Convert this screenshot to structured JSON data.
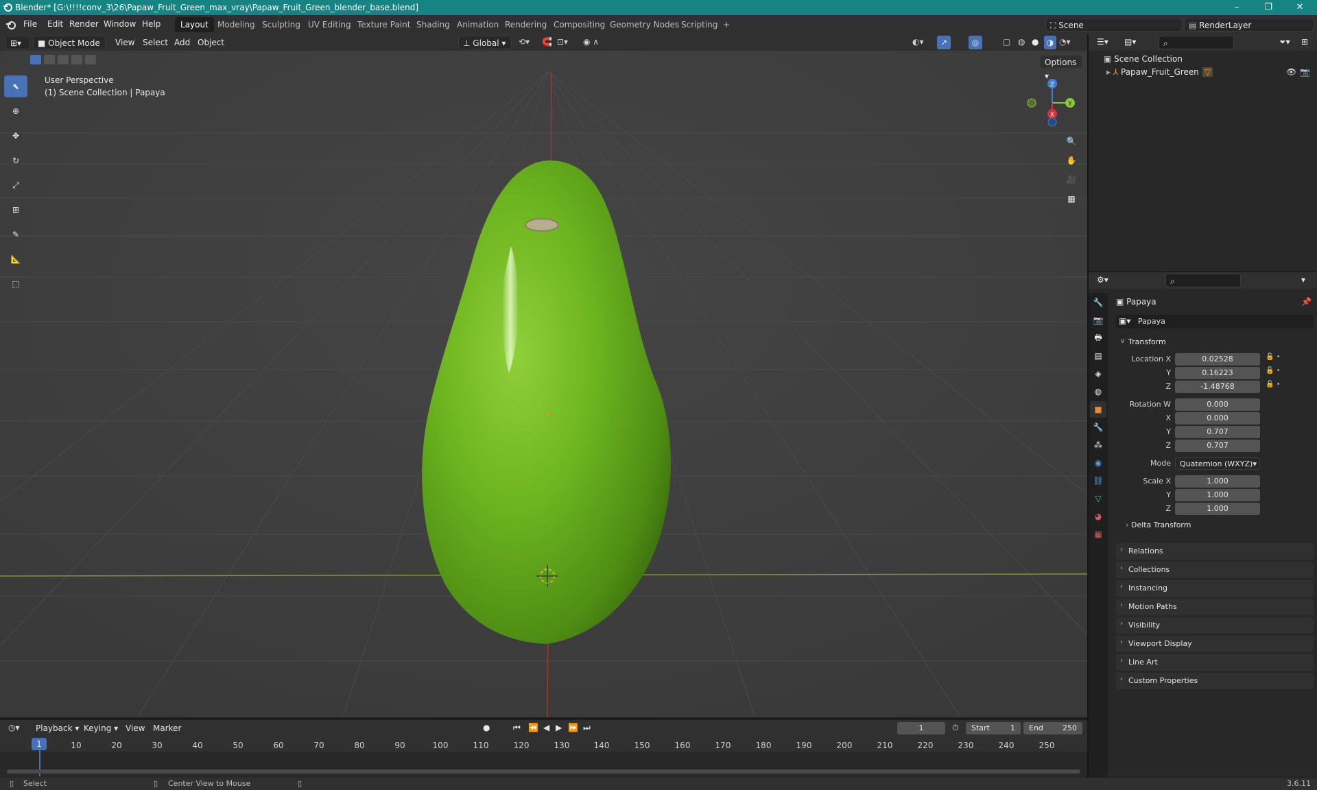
{
  "window": {
    "title": "Blender* [G:\\!!!!conv_3\\26\\Papaw_Fruit_Green_max_vray\\Papaw_Fruit_Green_blender_base.blend]",
    "controls": [
      "–",
      "❐",
      "✕"
    ]
  },
  "menus": [
    "File",
    "Edit",
    "Render",
    "Window",
    "Help"
  ],
  "workspaces": [
    "Layout",
    "Modeling",
    "Sculpting",
    "UV Editing",
    "Texture Paint",
    "Shading",
    "Animation",
    "Rendering",
    "Compositing",
    "Geometry Nodes",
    "Scripting",
    "+"
  ],
  "active_workspace": "Layout",
  "scene": {
    "name": "Scene",
    "view_layer": "RenderLayer"
  },
  "viewport_header": {
    "mode": "Object Mode",
    "menus": [
      "View",
      "Select",
      "Add",
      "Object"
    ],
    "orientation": "Global",
    "options": "Options"
  },
  "viewport": {
    "perspective_label": "User Perspective",
    "collection_label": "(1) Scene Collection | Papaya",
    "gizmo_axes": [
      "Z",
      "Y",
      "X"
    ]
  },
  "outliner": {
    "root": "Scene Collection",
    "items": [
      {
        "label": "Papaw_Fruit_Green"
      }
    ]
  },
  "properties": {
    "object_name": "Papaya",
    "data_name": "Papaya",
    "transform": {
      "title": "Transform",
      "location": [
        {
          "label": "Location X",
          "value": "0.02528"
        },
        {
          "label": "Y",
          "value": "0.16223"
        },
        {
          "label": "Z",
          "value": "-1.48768"
        }
      ],
      "rotation": [
        {
          "label": "Rotation W",
          "value": "0.000"
        },
        {
          "label": "X",
          "value": "0.000"
        },
        {
          "label": "Y",
          "value": "0.707"
        },
        {
          "label": "Z",
          "value": "0.707"
        }
      ],
      "mode_label": "Mode",
      "mode_value": "Quaternion (WXYZ)",
      "scale": [
        {
          "label": "Scale X",
          "value": "1.000"
        },
        {
          "label": "Y",
          "value": "1.000"
        },
        {
          "label": "Z",
          "value": "1.000"
        }
      ],
      "delta": "Delta Transform"
    },
    "panels": [
      "Relations",
      "Collections",
      "Instancing",
      "Motion Paths",
      "Visibility",
      "Viewport Display",
      "Line Art",
      "Custom Properties"
    ]
  },
  "timeline": {
    "menus": [
      "Playback",
      "Keying",
      "View",
      "Marker"
    ],
    "current_frame": "1",
    "start_label": "Start",
    "start": "1",
    "end_label": "End",
    "end": "250",
    "ticks": [
      "1",
      "10",
      "20",
      "30",
      "40",
      "50",
      "60",
      "70",
      "80",
      "90",
      "100",
      "110",
      "120",
      "130",
      "140",
      "150",
      "160",
      "170",
      "180",
      "190",
      "200",
      "210",
      "220",
      "230",
      "240",
      "250"
    ]
  },
  "statusbar": {
    "left": "Select",
    "middle": "Center View to Mouse",
    "version": "3.6.11"
  },
  "colors": {
    "titlebar": "#178484",
    "accent": "#4772b3",
    "fruit": "#6fb31f",
    "x_axis": "#d6323a",
    "y_axis": "#8bc53a",
    "z_axis": "#3b7fd9"
  }
}
